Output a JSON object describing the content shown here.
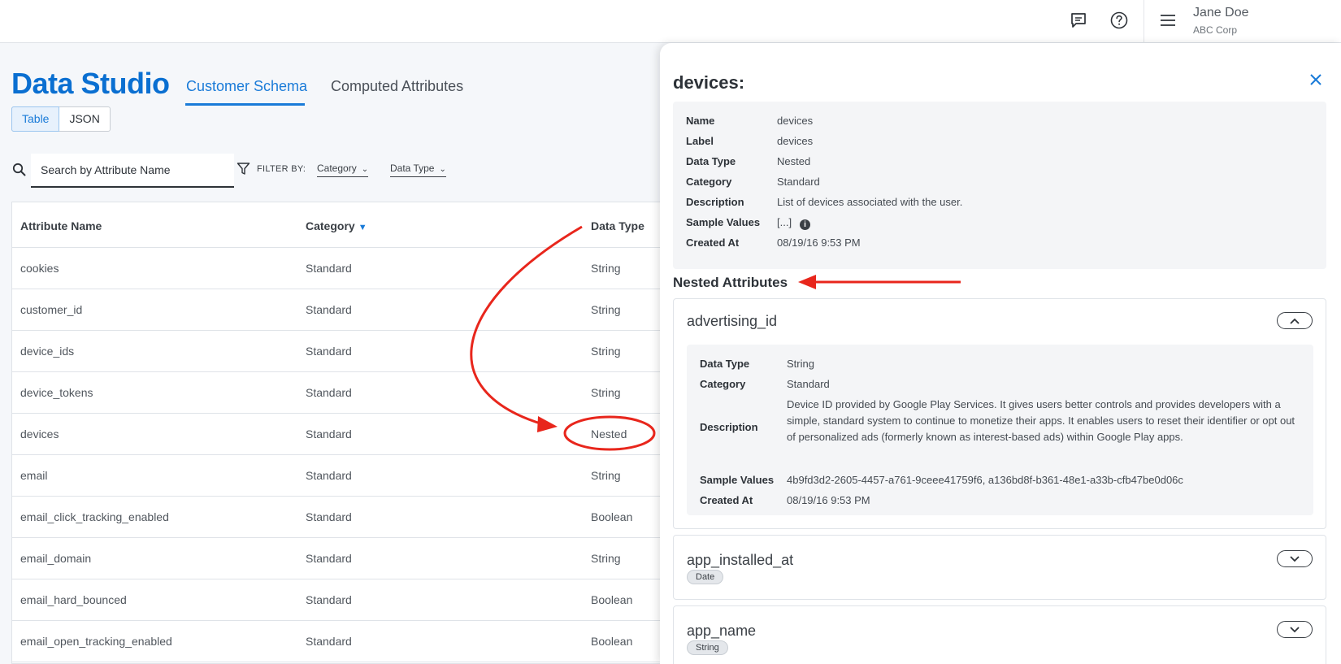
{
  "header": {
    "user_name": "Jane Doe",
    "user_org": "ABC Corp",
    "icons": [
      "chat-icon",
      "help-icon",
      "menu-icon"
    ]
  },
  "page": {
    "title": "Data Studio",
    "tabs": [
      {
        "label": "Customer Schema",
        "active": true
      },
      {
        "label": "Computed Attributes",
        "active": false
      }
    ],
    "view_toggle": {
      "table": "Table",
      "json": "JSON",
      "selected": "Table"
    },
    "search_placeholder": "Search by Attribute Name",
    "filter_label": "FILTER BY:",
    "filters": [
      "Category",
      "Data Type"
    ]
  },
  "table": {
    "columns": [
      "Attribute Name",
      "Category",
      "Data Type"
    ],
    "sort_column": "Category",
    "rows": [
      {
        "name": "cookies",
        "category": "Standard",
        "type": "String"
      },
      {
        "name": "customer_id",
        "category": "Standard",
        "type": "String"
      },
      {
        "name": "device_ids",
        "category": "Standard",
        "type": "String"
      },
      {
        "name": "device_tokens",
        "category": "Standard",
        "type": "String"
      },
      {
        "name": "devices",
        "category": "Standard",
        "type": "Nested"
      },
      {
        "name": "email",
        "category": "Standard",
        "type": "String"
      },
      {
        "name": "email_click_tracking_enabled",
        "category": "Standard",
        "type": "Boolean"
      },
      {
        "name": "email_domain",
        "category": "Standard",
        "type": "String"
      },
      {
        "name": "email_hard_bounced",
        "category": "Standard",
        "type": "Boolean"
      },
      {
        "name": "email_open_tracking_enabled",
        "category": "Standard",
        "type": "Boolean"
      }
    ]
  },
  "drawer": {
    "title": "devices:",
    "details": {
      "name_label": "Name",
      "name": "devices",
      "label_label": "Label",
      "label": "devices",
      "type_label": "Data Type",
      "type": "Nested",
      "category_label": "Category",
      "category": "Standard",
      "description_label": "Description",
      "description": "List of devices associated with the user.",
      "samples_label": "Sample Values",
      "samples": "[...]",
      "created_label": "Created At",
      "created": "08/19/16 9:53 PM"
    },
    "nested_title": "Nested Attributes",
    "nested": [
      {
        "name": "advertising_id",
        "expanded": true,
        "type_label": "Data Type",
        "type": "String",
        "category_label": "Category",
        "category": "Standard",
        "description_label": "Description",
        "description": "Device ID provided by Google Play Services. It gives users better controls and provides developers with a simple, standard system to continue to monetize their apps. It enables users to reset their identifier or opt out of personalized ads (formerly known as interest-based ads) within Google Play apps.",
        "samples_label": "Sample Values",
        "samples": "4b9fd3d2-2605-4457-a761-9ceee41759f6, a136bd8f-b361-48e1-a33b-cfb47be0d06c",
        "created_label": "Created At",
        "created": "08/19/16 9:53 PM"
      },
      {
        "name": "app_installed_at",
        "expanded": false,
        "badge": "Date"
      },
      {
        "name": "app_name",
        "expanded": false,
        "badge": "String"
      }
    ]
  },
  "colors": {
    "accent": "#1a7bd8",
    "annotation": "#e8261c"
  }
}
